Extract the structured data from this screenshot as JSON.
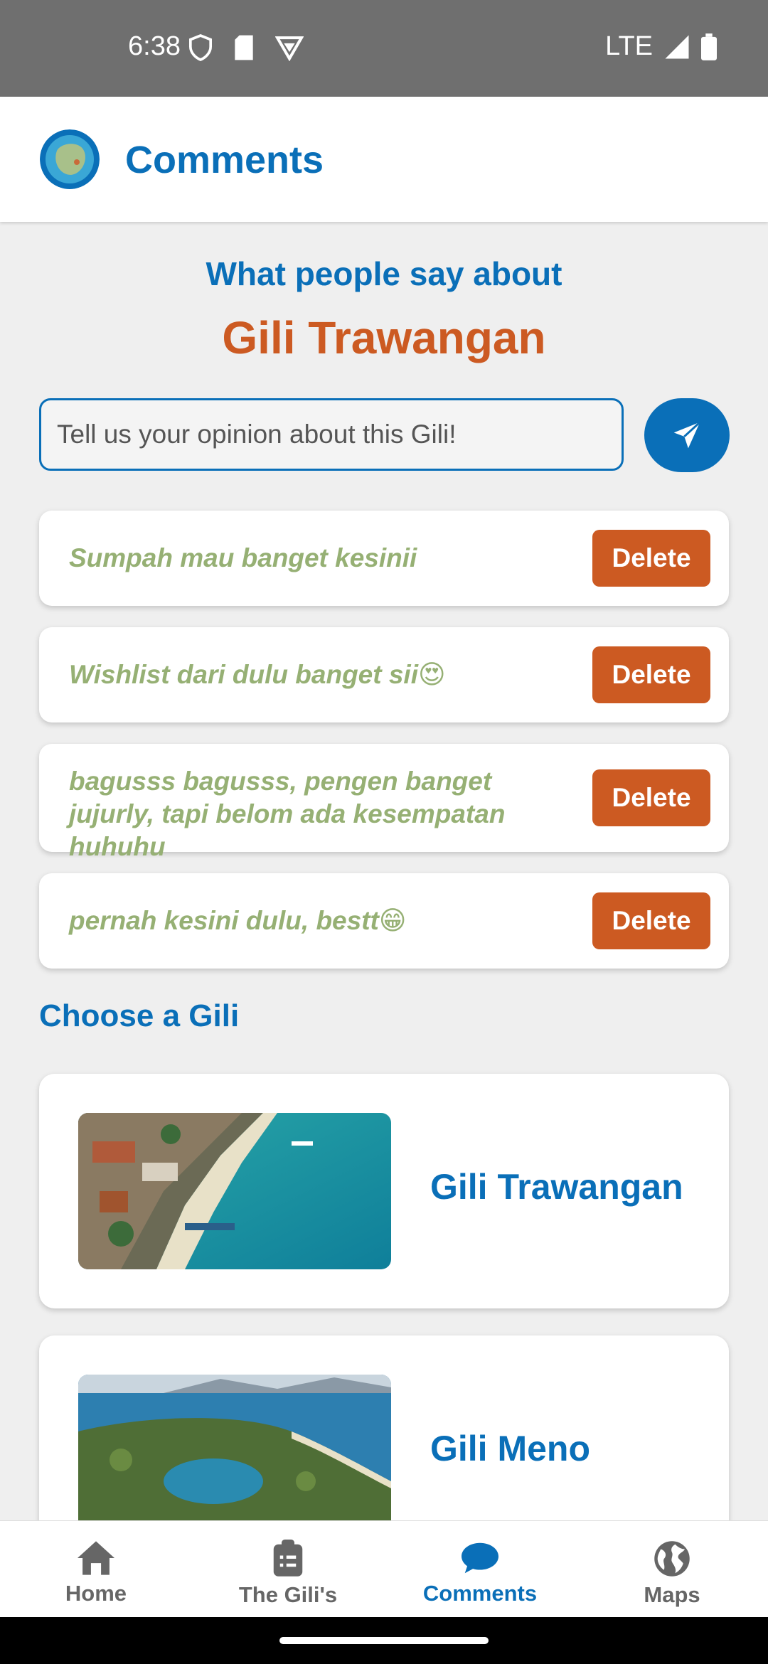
{
  "status_bar": {
    "time": "6:38",
    "network": "LTE"
  },
  "app_bar": {
    "title": "Comments"
  },
  "header": {
    "subtitle": "What people say about",
    "gili_name": "Gili Trawangan"
  },
  "comment_input": {
    "placeholder": "Tell us your opinion about this Gili!"
  },
  "comments": [
    {
      "text": "Sumpah mau banget kesinii",
      "delete_label": "Delete"
    },
    {
      "text": "Wishlist dari dulu banget sii😍",
      "delete_label": "Delete"
    },
    {
      "text": "bagusss bagusss, pengen banget jujurly, tapi belom ada kesempatan huhuhu",
      "delete_label": "Delete"
    },
    {
      "text": "pernah kesini dulu, bestt😁",
      "delete_label": "Delete"
    }
  ],
  "choose_section": {
    "title": "Choose a Gili",
    "items": [
      {
        "name": "Gili Trawangan"
      },
      {
        "name": "Gili Meno"
      }
    ]
  },
  "bottom_nav": {
    "items": [
      {
        "label": "Home",
        "icon": "home-icon"
      },
      {
        "label": "The Gili's",
        "icon": "clipboard-list-icon"
      },
      {
        "label": "Comments",
        "icon": "chat-bubble-icon",
        "active": true
      },
      {
        "label": "Maps",
        "icon": "globe-icon"
      }
    ]
  },
  "colors": {
    "primary": "#0a6fb8",
    "accent": "#cc5a22",
    "comment_text": "#96b074"
  }
}
